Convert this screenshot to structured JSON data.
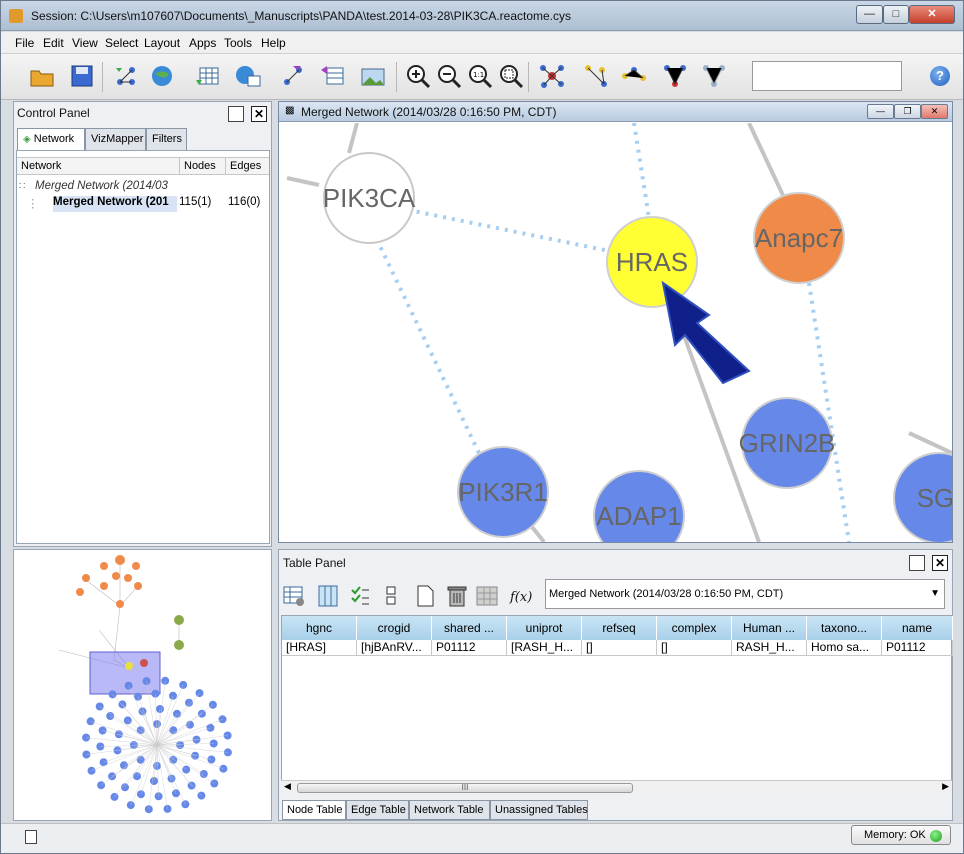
{
  "window": {
    "title": "Session: C:\\Users\\m107607\\Documents\\_Manuscripts\\PANDA\\test.2014-03-28\\PIK3CA.reactome.cys"
  },
  "menu": [
    "File",
    "Edit",
    "View",
    "Select",
    "Layout",
    "Apps",
    "Tools",
    "Help"
  ],
  "toolbar": {
    "help_label": "?"
  },
  "control_panel": {
    "title": "Control Panel",
    "tabs": [
      "Network",
      "VizMapper",
      "Filters"
    ],
    "columns": [
      "Network",
      "Nodes",
      "Edges"
    ],
    "networks": [
      {
        "name": "Merged Network (2014/03",
        "nodes": "",
        "edges": ""
      },
      {
        "name": "Merged Network (201",
        "nodes": "115(1)",
        "edges": "116(0)"
      }
    ]
  },
  "network_view": {
    "title": "Merged Network (2014/03/28 0:16:50 PM, CDT)",
    "nodes": [
      {
        "label": "PIK3CA",
        "color": "#ffffff"
      },
      {
        "label": "HRAS",
        "color": "#ffff33"
      },
      {
        "label": "Anapc7",
        "color": "#f08a48"
      },
      {
        "label": "GRIN2B",
        "color": "#6688e8"
      },
      {
        "label": "PIK3R1",
        "color": "#6688e8"
      },
      {
        "label": "ADAP1",
        "color": "#6688e8"
      },
      {
        "label": "SGI",
        "color": "#6688e8"
      }
    ]
  },
  "table_panel": {
    "title": "Table Panel",
    "selected_network": "Merged Network (2014/03/28 0:16:50 PM, CDT)",
    "columns": [
      "hgnc",
      "crogid",
      "shared ...",
      "uniprot",
      "refseq",
      "complex",
      "Human ...",
      "taxono...",
      "name"
    ],
    "rows": [
      [
        "[HRAS]",
        "[hjBAnRV...",
        "P01112",
        "[RASH_H...",
        "[]",
        "[]",
        "RASH_H...",
        "Homo sa...",
        "P01112"
      ]
    ],
    "scroll_thumb": "III",
    "tabs": [
      "Node Table",
      "Edge Table",
      "Network Table",
      "Unassigned Tables"
    ]
  },
  "status": {
    "memory": "Memory: OK"
  }
}
